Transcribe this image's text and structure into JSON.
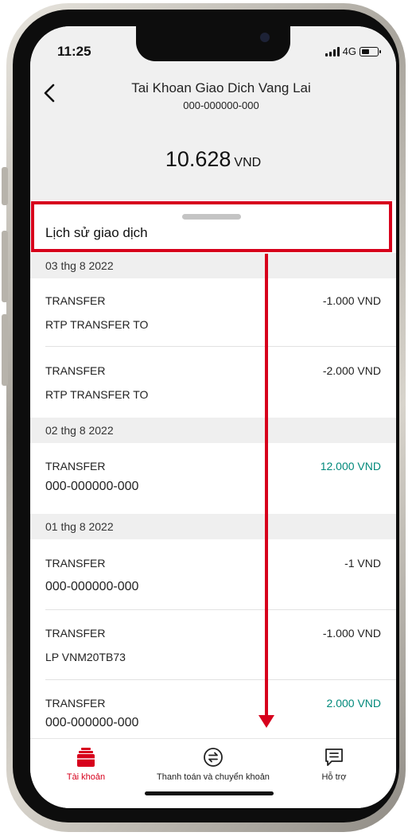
{
  "status_bar": {
    "time": "11:25",
    "network": "4G"
  },
  "header": {
    "title": "Tai Khoan Giao Dich Vang Lai",
    "account_number": "000-000000-000",
    "balance_amount": "10.628",
    "balance_currency": "VND"
  },
  "history": {
    "title": "Lịch sử giao dịch",
    "groups": [
      {
        "date": "03 thg 8 2022",
        "transactions": [
          {
            "type": "TRANSFER",
            "description": "RTP TRANSFER TO",
            "amount": "-1.000 VND"
          },
          {
            "type": "TRANSFER",
            "description": "RTP TRANSFER TO",
            "amount": "-2.000 VND"
          }
        ]
      },
      {
        "date": "02 thg 8 2022",
        "transactions": [
          {
            "type": "TRANSFER",
            "description": "000-000000-000",
            "amount": "12.000 VND"
          }
        ]
      },
      {
        "date": "01 thg 8 2022",
        "transactions": [
          {
            "type": "TRANSFER",
            "description": "000-000000-000",
            "amount": "-1 VND"
          },
          {
            "type": "TRANSFER",
            "description": "LP VNM20TB73",
            "amount": "-1.000 VND"
          },
          {
            "type": "TRANSFER",
            "description": "000-000000-000",
            "amount": "2.000 VND"
          }
        ]
      }
    ]
  },
  "tabbar": {
    "items": [
      {
        "label": "Tài khoản",
        "icon": "wallet-icon",
        "active": true
      },
      {
        "label": "Thanh toán và chuyển khoản",
        "icon": "transfer-icon",
        "active": false
      },
      {
        "label": "Hỗ trợ",
        "icon": "chat-icon",
        "active": false
      }
    ]
  },
  "colors": {
    "accent_red": "#d7001c",
    "positive_teal": "#00897b",
    "header_bg": "#f0f0f0"
  }
}
